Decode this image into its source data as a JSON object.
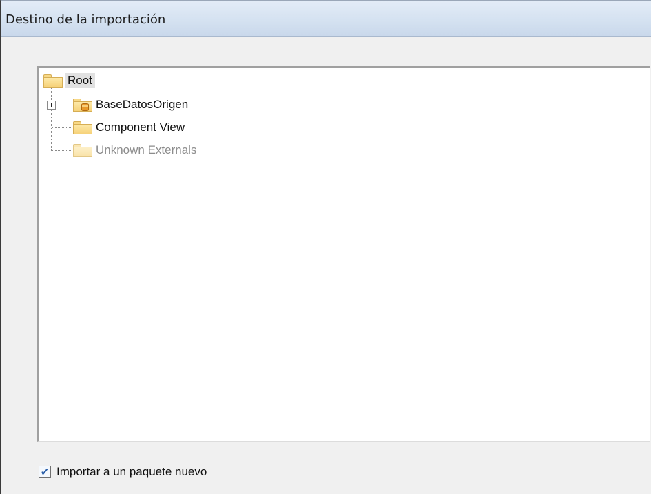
{
  "window": {
    "title": "Destino de la importación"
  },
  "tree": {
    "root": {
      "label": "Root",
      "icon": "folder-icon"
    },
    "children": [
      {
        "label": "BaseDatosOrigen",
        "icon": "database-folder-icon",
        "expandable": true,
        "expanded": false
      },
      {
        "label": "Component View",
        "icon": "folder-icon",
        "expandable": false
      },
      {
        "label": "Unknown Externals",
        "icon": "folder-icon",
        "expandable": false,
        "disabled": true
      }
    ]
  },
  "options": {
    "import_new_package": {
      "label": "Importar a un paquete nuevo",
      "checked": true,
      "check_glyph": "✔"
    }
  }
}
